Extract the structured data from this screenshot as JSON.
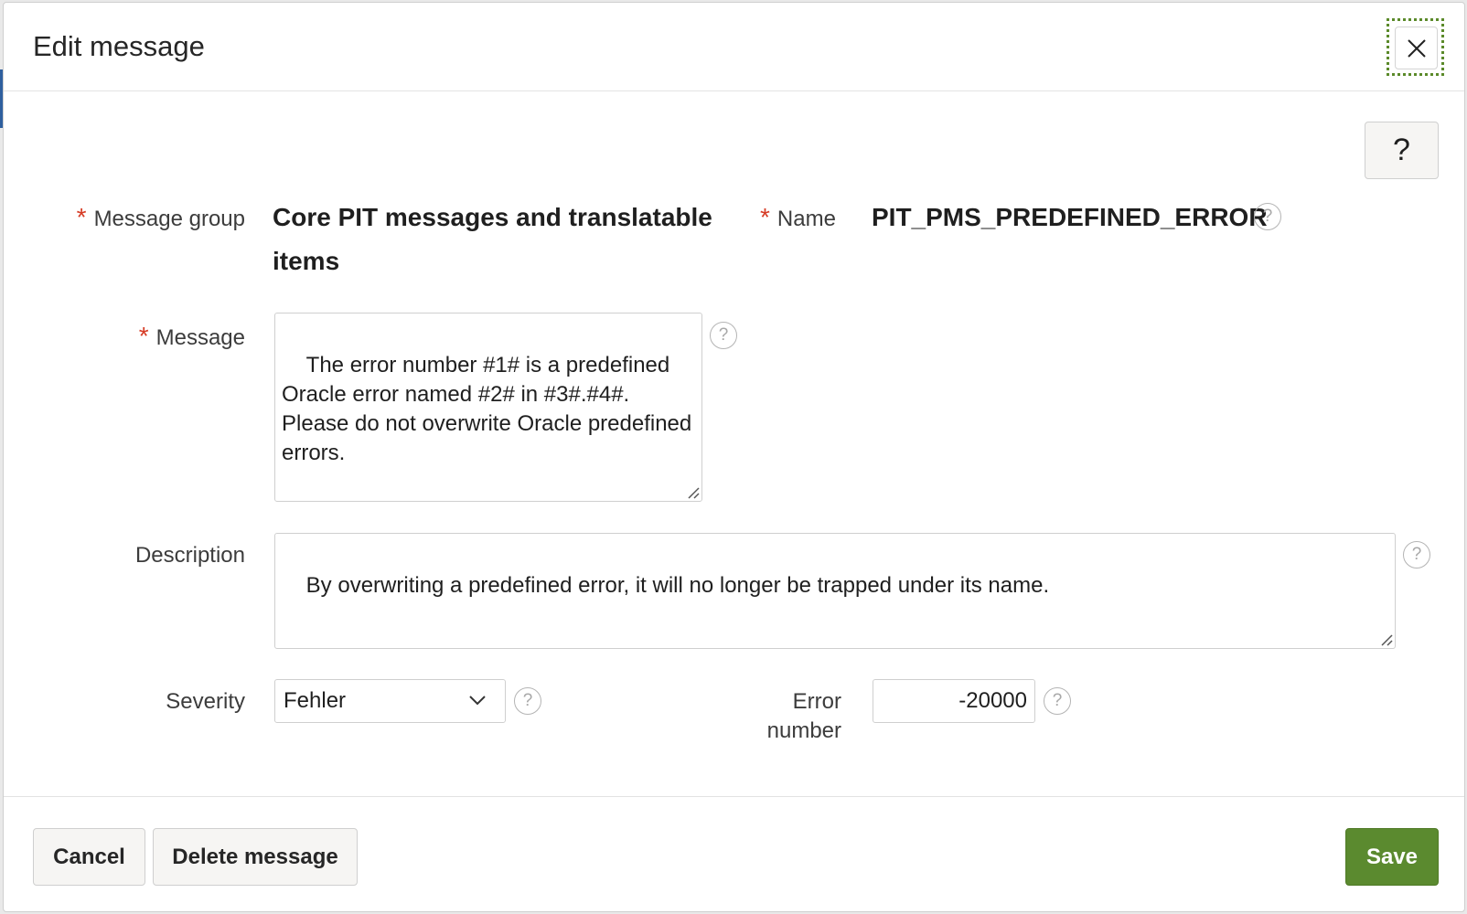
{
  "dialog": {
    "title": "Edit message",
    "close_icon": "close-icon",
    "help_label": "?"
  },
  "form": {
    "required_marker": "*",
    "message_group": {
      "label": "Message group",
      "value_line1": "Core PIT messages and translatable",
      "value_line2": "items"
    },
    "name": {
      "label": "Name",
      "value": "PIT_PMS_PREDEFINED_ERROR"
    },
    "message": {
      "label": "Message",
      "value": "The error number #1# is a predefined\nOracle error named #2# in #3#.#4#.\nPlease do not overwrite Oracle predefined\nerrors."
    },
    "description": {
      "label": "Description",
      "value": "By overwriting a predefined error, it will no longer be trapped under its name."
    },
    "severity": {
      "label": "Severity",
      "selected": "Fehler"
    },
    "error_number": {
      "label_line1": "Error",
      "label_line2": "number",
      "value": "-20000"
    },
    "field_help_glyph": "?"
  },
  "footer": {
    "cancel_label": "Cancel",
    "delete_label": "Delete message",
    "save_label": "Save"
  },
  "colors": {
    "primary": "#5b8a2f",
    "required": "#d63b25",
    "focus_outline": "#5b8a2a"
  }
}
